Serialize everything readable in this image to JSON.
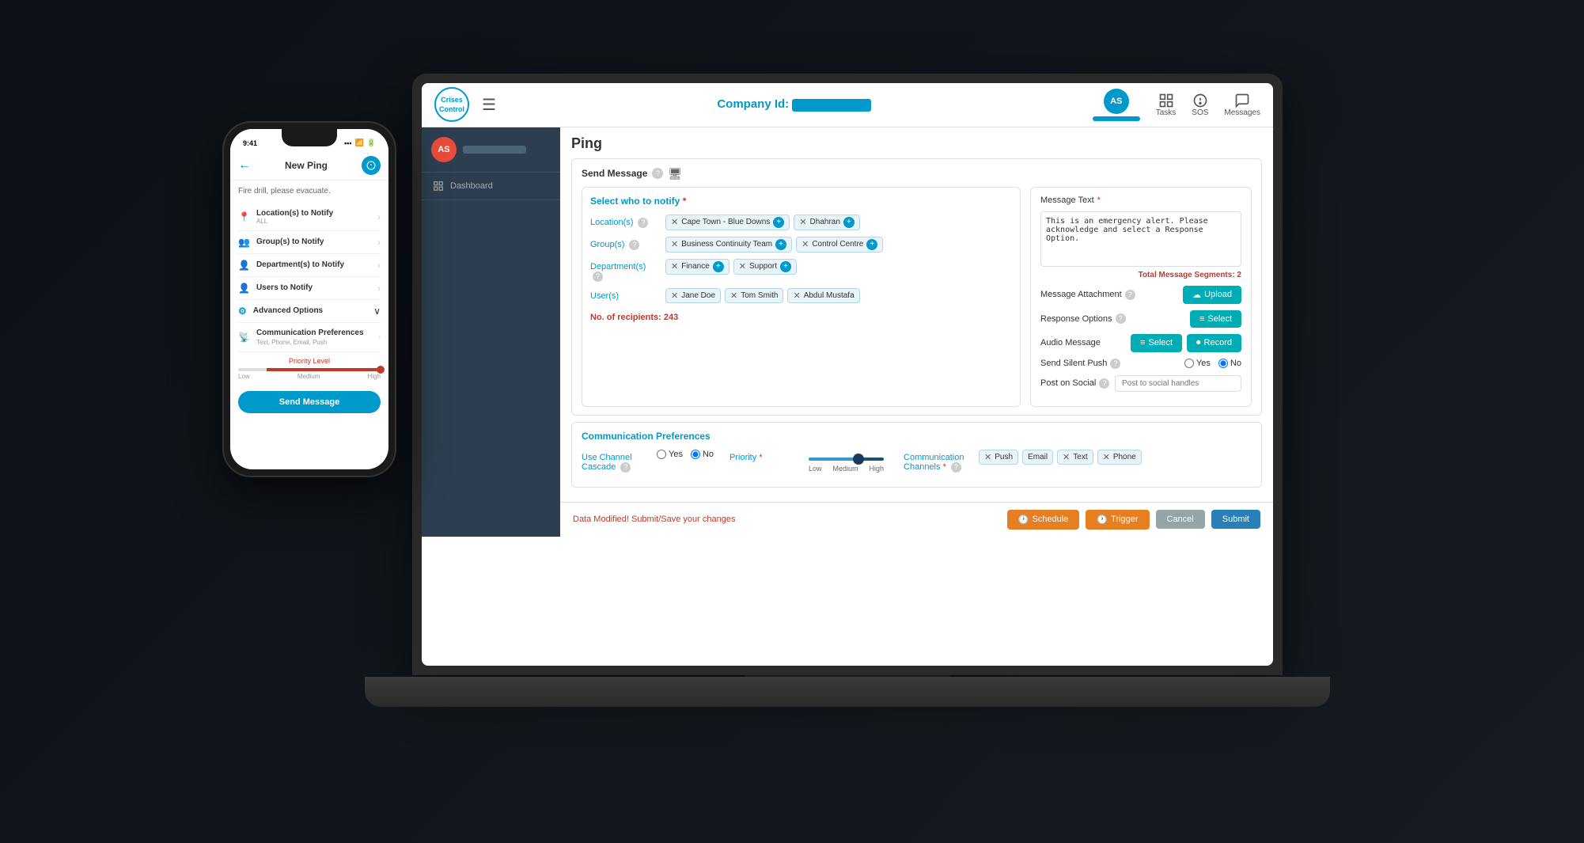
{
  "app": {
    "title": "Ping",
    "company_label": "Company Id:",
    "company_bar": ""
  },
  "topnav": {
    "logo_text": "Crises\nControl",
    "hamburger": "☰",
    "tasks_label": "Tasks",
    "sos_label": "SOS",
    "messages_label": "Messages"
  },
  "sidebar": {
    "user_initials": "AS",
    "items": [
      {
        "label": "Dashboard",
        "icon": "dashboard"
      }
    ]
  },
  "send_message": {
    "section_title": "Send Message",
    "select_who_label": "Select who to notify",
    "locations_label": "Location(s)",
    "locations": [
      "Cape Town - Blue Downs",
      "Dhahran"
    ],
    "groups_label": "Group(s)",
    "groups": [
      "Business Continuity Team",
      "Control Centre"
    ],
    "departments_label": "Department(s)",
    "departments": [
      "Finance",
      "Support"
    ],
    "users_label": "User(s)",
    "users": [
      "Jane Doe",
      "Tom Smith",
      "Abdul Mustafa"
    ],
    "recipients_label": "No. of recipients:",
    "recipients_count": "243"
  },
  "comm_prefs": {
    "section_title": "Communication Preferences",
    "channel_cascade_label": "Use Channel Cascade",
    "channel_yes": "Yes",
    "channel_no": "No",
    "priority_label": "Priority",
    "priority_low": "Low",
    "priority_medium": "Medium",
    "priority_high": "High",
    "comm_channels_label": "Communication Channels",
    "channels": [
      "Push",
      "Email",
      "Text",
      "Phone"
    ]
  },
  "right_panel": {
    "message_text_label": "Message Text",
    "message_text_value": "This is an emergency alert. Please acknowledge and select a Response Option.",
    "total_segments_label": "Total Message Segments: 2",
    "attachment_label": "Message Attachment",
    "upload_btn": "Upload",
    "response_options_label": "Response Options",
    "select_btn": "Select",
    "audio_message_label": "Audio Message",
    "audio_select_btn": "Select",
    "audio_record_btn": "Record",
    "send_silent_label": "Send Silent Push",
    "yes_label": "Yes",
    "no_label": "No",
    "post_social_label": "Post on Social",
    "post_placeholder": "Post to social handles"
  },
  "footer": {
    "modified_message": "Data Modified! Submit/Save your changes",
    "schedule_btn": "Schedule",
    "trigger_btn": "Trigger",
    "cancel_btn": "Cancel",
    "submit_btn": "Submit"
  },
  "phone": {
    "time": "9:41",
    "title": "New Ping",
    "message": "Fire drill, please evacuate.",
    "items": [
      {
        "label": "Location(s) to Notify",
        "sub": "ALL",
        "icon": "📍"
      },
      {
        "label": "Group(s) to Notify",
        "sub": "",
        "icon": "👥"
      },
      {
        "label": "Department(s) to Notify",
        "sub": "",
        "icon": "👤"
      },
      {
        "label": "Users to Notify",
        "sub": "",
        "icon": "👤"
      }
    ],
    "advanced_options": "Advanced Options",
    "comm_prefs_label": "Communication Preferences",
    "comm_prefs_sub": "Text, Phone, Email, Push",
    "priority_label": "Priority Level",
    "priority_low": "Low",
    "priority_medium": "Medium",
    "priority_high": "High",
    "send_btn": "Send Message"
  }
}
